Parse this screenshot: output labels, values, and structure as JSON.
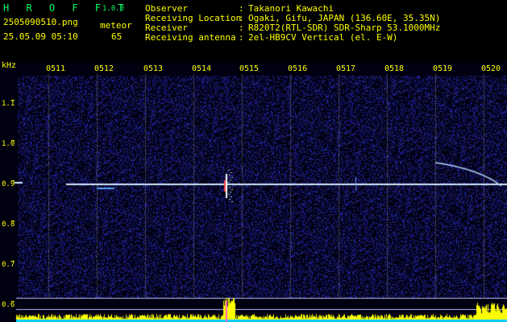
{
  "app": {
    "name": "H R O F F T",
    "version": "1.0.0"
  },
  "capture": {
    "filename": "2505090510.png",
    "datetime": "25.05.09 05:10",
    "meteor_label": "meteor",
    "meteor_count": "65"
  },
  "info": [
    {
      "key": "Observer",
      "sep": ":",
      "value": "Takanori Kawachi"
    },
    {
      "key": "Receiving Location",
      "sep": ":",
      "value": "Ogaki, Gifu, JAPAN (136.60E, 35.35N)"
    },
    {
      "key": "Receiver",
      "sep": ":",
      "value": "R820T2(RTL-SDR) SDR-Sharp 53.1000MHz"
    },
    {
      "key": "Receiving antenna",
      "sep": ":",
      "value": "2el-HB9CV Vertical (el. E-W)"
    }
  ],
  "axis": {
    "unit": "kHz",
    "time_ticks": [
      "0511",
      "0512",
      "0513",
      "0514",
      "0515",
      "0516",
      "0517",
      "0518",
      "0519",
      "0520"
    ],
    "freq_ticks": [
      "1.1",
      "1.0",
      "0.9",
      "0.8",
      "0.7",
      "0.6"
    ]
  },
  "colors": {
    "text_green": "#00ff66",
    "text_yellow": "#ffff00",
    "background": "#000000",
    "spectrum_noise": "#1a1a8c",
    "carrier": "#cfe8ff",
    "meteor_echo": "#ff4040",
    "level_bar": "#ffff00",
    "level_base": "#00ccff"
  }
}
